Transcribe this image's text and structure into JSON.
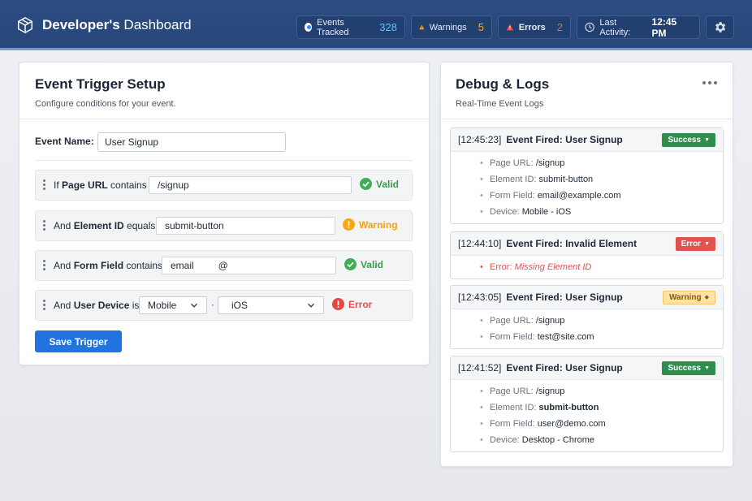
{
  "header": {
    "title_bold": "Developer's",
    "title_rest": " Dashboard",
    "events_label": "Events Tracked",
    "events_count": "328",
    "warnings_label": "Warnings",
    "warnings_count": "5",
    "errors_label": "Errors",
    "errors_count": "2",
    "last_activity_label": "Last Activity:",
    "last_activity_time": "12:45 PM",
    "settings_icon": "gear-icon"
  },
  "colors": {
    "accent": "#2174e0",
    "success": "#2f8e4e",
    "warning": "#f2a20c",
    "error": "#e05252",
    "header_bg": "#2d4d82"
  },
  "setup": {
    "title": "Event Trigger Setup",
    "subtitle": "Configure conditions for your event.",
    "event_name_label": "Event Name:",
    "event_name_value": "User Signup",
    "rules": [
      {
        "prefix": "If ",
        "bold": "Page URL",
        "suffix": " contains",
        "value": "/signup",
        "status": "Valid"
      },
      {
        "prefix": "And ",
        "bold": "Element ID",
        "suffix": " equals",
        "value": "submit-button",
        "status": "Warning"
      },
      {
        "prefix": "And ",
        "bold": "Form Field",
        "suffix": " contains",
        "value": "email         @",
        "status": "Valid"
      },
      {
        "prefix": "And ",
        "bold": "User Device",
        "suffix": " is",
        "select1": "Mobile",
        "separator": "·",
        "select2": "iOS",
        "status": "Error"
      }
    ],
    "save_label": "Save Trigger"
  },
  "logs": {
    "title": "Debug & Logs",
    "subtitle": "Real-Time Event Logs",
    "entries": [
      {
        "time": "[12:45:23]",
        "event": "Event Fired: User Signup",
        "badge": "Success",
        "items": [
          {
            "k": "Page URL:",
            "v": "/signup"
          },
          {
            "k": "Element ID:",
            "v": "submit-button"
          },
          {
            "k": "Form Field:",
            "v": "email@example.com"
          },
          {
            "k": "Device:",
            "v": "Mobile - iOS"
          }
        ]
      },
      {
        "time": "[12:44:10]",
        "event": "Event Fired: Invalid Element",
        "badge": "Error",
        "items": [
          {
            "k": "Error:",
            "v": "Missing Element ID"
          }
        ]
      },
      {
        "time": "[12:43:05]",
        "event": "Event Fired: User Signup",
        "badge": "Warning",
        "items": [
          {
            "k": "Page URL:",
            "v": "/signup"
          },
          {
            "k": "Form Field:",
            "v": "test@site.com"
          }
        ]
      },
      {
        "time": "[12:41:52]",
        "event": "Event Fired: User Signup",
        "badge": "Success",
        "items": [
          {
            "k": "Page URL:",
            "v": "/signup"
          },
          {
            "k": "Element ID:",
            "v": "submit-button"
          },
          {
            "k": "Form Field:",
            "v": "user@demo.com"
          },
          {
            "k": "Device:",
            "v": "Desktop - Chrome"
          }
        ]
      }
    ]
  }
}
